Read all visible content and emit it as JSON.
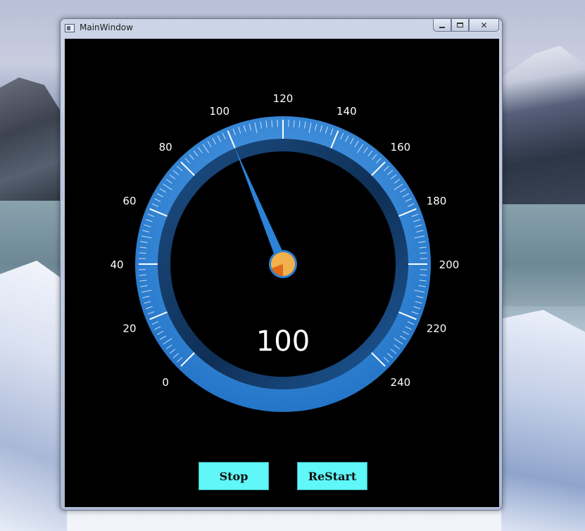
{
  "window": {
    "title": "MainWindow",
    "controls": {
      "minimize": "minimize",
      "maximize": "maximize",
      "close": "close"
    }
  },
  "gauge": {
    "min": 0,
    "max": 240,
    "value": 100,
    "value_label": "100",
    "major_step": 20,
    "minor_per_major": 10,
    "start_angle_deg": 225,
    "sweep_deg": 270,
    "tick_labels": [
      "0",
      "20",
      "40",
      "60",
      "80",
      "100",
      "120",
      "140",
      "160",
      "180",
      "200",
      "220",
      "240"
    ],
    "colors": {
      "bezel": "#2b82d8",
      "bezel_light": "#5aa7ee",
      "inner_ring": "#123b66",
      "ticks": "#ffffff",
      "needle": "#2b82d8",
      "hub_slices": [
        "#2f7ad6",
        "#1a9a3a",
        "#e06a1a",
        "#f2b14a"
      ],
      "value_text": "#ffffff",
      "labels": "#ffffff"
    }
  },
  "buttons": {
    "stop": "Stop",
    "restart": "ReStart",
    "color": "#5ff7f7"
  }
}
